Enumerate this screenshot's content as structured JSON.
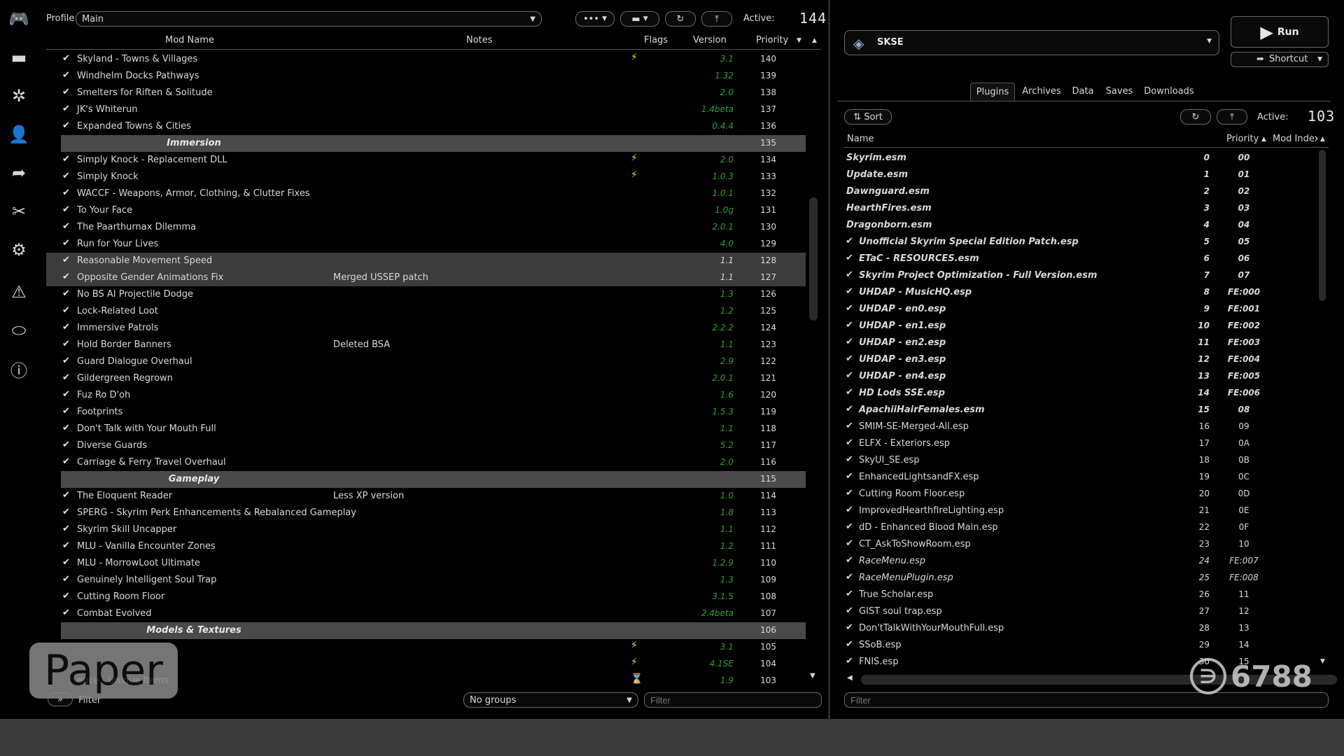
{
  "toolbar": {
    "profile_label": "Profile",
    "profile_value": "Main",
    "more_label": "•••",
    "active_label": "Active:",
    "active_count": "144"
  },
  "modlist": {
    "headers": {
      "name": "Mod Name",
      "notes": "Notes",
      "flags": "Flags",
      "version": "Version",
      "priority": "Priority"
    },
    "rows": [
      {
        "type": "mod",
        "name": "Skyland - Towns & Villages",
        "notes": "",
        "flag": "⚡",
        "version": "3.1",
        "priority": "140"
      },
      {
        "type": "mod",
        "name": "Windhelm Docks Pathways",
        "notes": "",
        "flag": "",
        "version": "1.32",
        "priority": "139"
      },
      {
        "type": "mod",
        "name": "Smelters for Riften & Solitude",
        "notes": "",
        "flag": "",
        "version": "2.0",
        "priority": "138"
      },
      {
        "type": "mod",
        "name": "JK's Whiterun",
        "notes": "",
        "flag": "",
        "version": "1.4beta",
        "priority": "137"
      },
      {
        "type": "mod",
        "name": "Expanded Towns & Cities",
        "notes": "",
        "flag": "",
        "version": "0.4.4",
        "priority": "136"
      },
      {
        "type": "sep",
        "name": "Immersion",
        "priority": "135"
      },
      {
        "type": "mod",
        "name": "Simply Knock - Replacement DLL",
        "notes": "",
        "flag": "⚡",
        "version": "2.0",
        "priority": "134"
      },
      {
        "type": "mod",
        "name": "Simply Knock",
        "notes": "",
        "flag": "⚡",
        "version": "1.0.3",
        "priority": "133"
      },
      {
        "type": "mod",
        "name": "WACCF - Weapons, Armor, Clothing, & Clutter Fixes",
        "notes": "",
        "flag": "",
        "version": "1.0.1",
        "priority": "132"
      },
      {
        "type": "mod",
        "name": "To Your Face",
        "notes": "",
        "flag": "",
        "version": "1.0g",
        "priority": "131"
      },
      {
        "type": "mod",
        "name": "The Paarthurnax Dilemma",
        "notes": "",
        "flag": "",
        "version": "2.0.1",
        "priority": "130"
      },
      {
        "type": "mod",
        "name": "Run for Your Lives",
        "notes": "",
        "flag": "",
        "version": "4.0",
        "priority": "129"
      },
      {
        "type": "mod",
        "name": "Reasonable Movement Speed",
        "notes": "",
        "flag": "",
        "version": "1.1",
        "priority": "128",
        "sel": true
      },
      {
        "type": "mod",
        "name": "Opposite Gender Animations Fix",
        "notes": "Merged USSEP patch",
        "flag": "",
        "version": "1.1",
        "priority": "127",
        "sel": true
      },
      {
        "type": "mod",
        "name": "No BS AI Projectile Dodge",
        "notes": "",
        "flag": "",
        "version": "1.3",
        "priority": "126"
      },
      {
        "type": "mod",
        "name": "Lock-Related Loot",
        "notes": "",
        "flag": "",
        "version": "1.2",
        "priority": "125"
      },
      {
        "type": "mod",
        "name": "Immersive Patrols",
        "notes": "",
        "flag": "",
        "version": "2.2.2",
        "priority": "124"
      },
      {
        "type": "mod",
        "name": "Hold Border Banners",
        "notes": "Deleted BSA",
        "flag": "",
        "version": "1.1",
        "priority": "123"
      },
      {
        "type": "mod",
        "name": "Guard Dialogue Overhaul",
        "notes": "",
        "flag": "",
        "version": "2.9",
        "priority": "122"
      },
      {
        "type": "mod",
        "name": "Gildergreen Regrown",
        "notes": "",
        "flag": "",
        "version": "2.0.1",
        "priority": "121"
      },
      {
        "type": "mod",
        "name": "Fuz Ro D'oh",
        "notes": "",
        "flag": "",
        "version": "1.6",
        "priority": "120"
      },
      {
        "type": "mod",
        "name": "Footprints",
        "notes": "",
        "flag": "",
        "version": "1.5.3",
        "priority": "119"
      },
      {
        "type": "mod",
        "name": "Don't Talk with Your Mouth Full",
        "notes": "",
        "flag": "",
        "version": "1.1",
        "priority": "118"
      },
      {
        "type": "mod",
        "name": "Diverse Guards",
        "notes": "",
        "flag": "",
        "version": "5.2",
        "priority": "117"
      },
      {
        "type": "mod",
        "name": "Carriage & Ferry Travel Overhaul",
        "notes": "",
        "flag": "",
        "version": "2.0",
        "priority": "116"
      },
      {
        "type": "sep",
        "name": "Gameplay",
        "priority": "115"
      },
      {
        "type": "mod",
        "name": "The Eloquent Reader",
        "notes": "Less XP version",
        "flag": "",
        "version": "1.0",
        "priority": "114"
      },
      {
        "type": "mod",
        "name": "SPERG - Skyrim Perk Enhancements & Rebalanced Gameplay",
        "notes": "",
        "flag": "",
        "version": "1.8",
        "priority": "113"
      },
      {
        "type": "mod",
        "name": "Skyrim Skill Uncapper",
        "notes": "",
        "flag": "",
        "version": "1.1",
        "priority": "112"
      },
      {
        "type": "mod",
        "name": "MLU - Vanilla Encounter Zones",
        "notes": "",
        "flag": "",
        "version": "1.2",
        "priority": "111"
      },
      {
        "type": "mod",
        "name": "MLU - MorrowLoot Ultimate",
        "notes": "",
        "flag": "",
        "version": "1.2.9",
        "priority": "110"
      },
      {
        "type": "mod",
        "name": "Genuinely Intelligent Soul Trap",
        "notes": "",
        "flag": "",
        "version": "1.3",
        "priority": "109"
      },
      {
        "type": "mod",
        "name": "Cutting Room Floor",
        "notes": "",
        "flag": "",
        "version": "3.1.5",
        "priority": "108"
      },
      {
        "type": "mod",
        "name": "Combat Evolved",
        "notes": "",
        "flag": "",
        "version": "2.4beta",
        "priority": "107"
      },
      {
        "type": "sep",
        "name": "Models & Textures",
        "priority": "106"
      },
      {
        "type": "mod",
        "name": "",
        "notes": "",
        "flag": "⚡",
        "version": "3.1",
        "priority": "105",
        "nocheck": true
      },
      {
        "type": "mod",
        "name": "",
        "notes": "",
        "flag": "⚡",
        "version": "4.1SE",
        "priority": "104",
        "nocheck": true
      },
      {
        "type": "mod",
        "name": "ence - Unique Items",
        "notes": "",
        "flag": "⌛",
        "version": "1.9",
        "priority": "103",
        "nocheck": true
      }
    ]
  },
  "modbottom": {
    "toggle": "»",
    "filter_label": "Filter",
    "groups_value": "No groups",
    "filter_placeholder": "Filter"
  },
  "executable": {
    "name": "SKSE",
    "run_label": "Run",
    "shortcut_label": "Shortcut"
  },
  "tabs": [
    "Plugins",
    "Archives",
    "Data",
    "Saves",
    "Downloads"
  ],
  "plugins_toolbar": {
    "sort_label": "Sort",
    "active_label": "Active:",
    "active_count": "103"
  },
  "plugins": {
    "headers": {
      "name": "Name",
      "priority": "Priority",
      "modindex": "Mod Index"
    },
    "rows": [
      {
        "name": "Skyrim.esm",
        "p": "0",
        "mi": "00",
        "style": "master"
      },
      {
        "name": "Update.esm",
        "p": "1",
        "mi": "01",
        "style": "master"
      },
      {
        "name": "Dawnguard.esm",
        "p": "2",
        "mi": "02",
        "style": "master"
      },
      {
        "name": "HearthFires.esm",
        "p": "3",
        "mi": "03",
        "style": "master"
      },
      {
        "name": "Dragonborn.esm",
        "p": "4",
        "mi": "04",
        "style": "master"
      },
      {
        "name": "Unofficial Skyrim Special Edition Patch.esp",
        "p": "5",
        "mi": "05",
        "style": "bold"
      },
      {
        "name": "ETaC - RESOURCES.esm",
        "p": "6",
        "mi": "06",
        "style": "bold"
      },
      {
        "name": "Skyrim Project Optimization - Full Version.esm",
        "p": "7",
        "mi": "07",
        "style": "bold"
      },
      {
        "name": "UHDAP - MusicHQ.esp",
        "p": "8",
        "mi": "FE:000",
        "style": "bold"
      },
      {
        "name": "UHDAP - en0.esp",
        "p": "9",
        "mi": "FE:001",
        "style": "bold"
      },
      {
        "name": "UHDAP - en1.esp",
        "p": "10",
        "mi": "FE:002",
        "style": "bold"
      },
      {
        "name": "UHDAP - en2.esp",
        "p": "11",
        "mi": "FE:003",
        "style": "bold"
      },
      {
        "name": "UHDAP - en3.esp",
        "p": "12",
        "mi": "FE:004",
        "style": "bold"
      },
      {
        "name": "UHDAP - en4.esp",
        "p": "13",
        "mi": "FE:005",
        "style": "bold"
      },
      {
        "name": "HD Lods SSE.esp",
        "p": "14",
        "mi": "FE:006",
        "style": "bold"
      },
      {
        "name": "ApachiiHairFemales.esm",
        "p": "15",
        "mi": "08",
        "style": "bold"
      },
      {
        "name": "SMIM-SE-Merged-All.esp",
        "p": "16",
        "mi": "09",
        "style": ""
      },
      {
        "name": "ELFX - Exteriors.esp",
        "p": "17",
        "mi": "0A",
        "style": ""
      },
      {
        "name": "SkyUI_SE.esp",
        "p": "18",
        "mi": "0B",
        "style": ""
      },
      {
        "name": "EnhancedLightsandFX.esp",
        "p": "19",
        "mi": "0C",
        "style": ""
      },
      {
        "name": "Cutting Room Floor.esp",
        "p": "20",
        "mi": "0D",
        "style": ""
      },
      {
        "name": "ImprovedHearthfireLighting.esp",
        "p": "21",
        "mi": "0E",
        "style": ""
      },
      {
        "name": "dD - Enhanced Blood Main.esp",
        "p": "22",
        "mi": "0F",
        "style": ""
      },
      {
        "name": "CT_AskToShowRoom.esp",
        "p": "23",
        "mi": "10",
        "style": ""
      },
      {
        "name": "RaceMenu.esp",
        "p": "24",
        "mi": "FE:007",
        "style": "ital"
      },
      {
        "name": "RaceMenuPlugin.esp",
        "p": "25",
        "mi": "FE:008",
        "style": "ital"
      },
      {
        "name": "True Scholar.esp",
        "p": "26",
        "mi": "11",
        "style": ""
      },
      {
        "name": "GIST soul trap.esp",
        "p": "27",
        "mi": "12",
        "style": ""
      },
      {
        "name": "Don'tTalkWithYourMouthFull.esp",
        "p": "28",
        "mi": "13",
        "style": ""
      },
      {
        "name": "SSoB.esp",
        "p": "29",
        "mi": "14",
        "style": ""
      },
      {
        "name": "FNIS.esp",
        "p": "30",
        "mi": "15",
        "style": ""
      }
    ]
  },
  "plugins_filter": {
    "placeholder": "Filter"
  },
  "watermarks": {
    "left": "Paper",
    "right": "6788"
  },
  "icons": [
    "gamepad-icon",
    "folder-icon",
    "nexus-icon",
    "user-icon",
    "share-icon",
    "tools-icon",
    "gear-icon",
    "warning-icon",
    "tag-icon",
    "info-icon"
  ]
}
